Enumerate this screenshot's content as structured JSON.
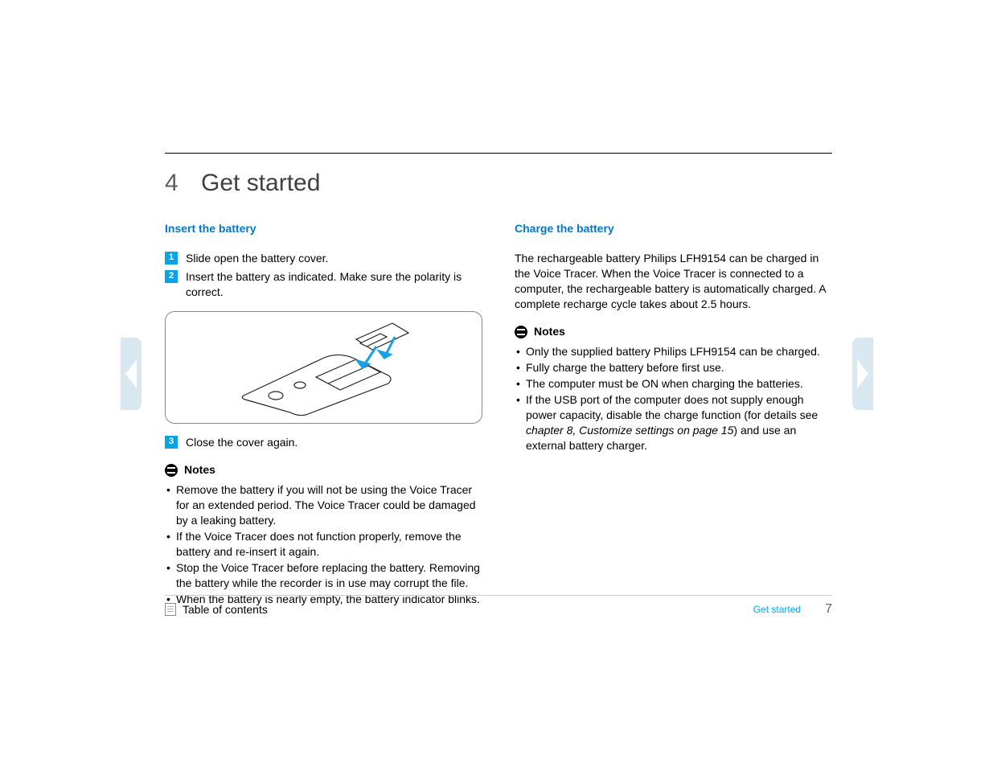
{
  "chapter": {
    "number": "4",
    "title": "Get started"
  },
  "left": {
    "heading": "Insert the battery",
    "steps": {
      "s1": {
        "num": "1",
        "text": "Slide open the battery cover."
      },
      "s2": {
        "num": "2",
        "text": "Insert the battery as indicated. Make sure the polarity is correct."
      },
      "s3": {
        "num": "3",
        "text": "Close the cover again."
      }
    },
    "notes_label": "Notes",
    "notes": {
      "n1": "Remove the battery if you will not be using the Voice Tracer for an extended period. The Voice Tracer could be damaged by a leaking battery.",
      "n2": "If the Voice Tracer does not function properly, remove the battery and re-insert it again.",
      "n3": "Stop the Voice Tracer before replacing the battery. Removing the battery while the recorder is in use may corrupt the file.",
      "n4": "When the battery is nearly empty, the battery indicator blinks."
    }
  },
  "right": {
    "heading": "Charge the battery",
    "para": "The rechargeable battery Philips LFH9154 can be charged in the Voice Tracer. When the Voice Tracer is connected to a computer, the rechargeable battery is automatically charged. A complete recharge cycle takes about 2.5 hours.",
    "notes_label": "Notes",
    "notes": {
      "n1": "Only the supplied battery Philips LFH9154 can be charged.",
      "n2": "Fully charge the battery before first use.",
      "n3": "The computer must be ON when charging the batteries.",
      "n4a": "If the USB port of the computer does not supply enough power capacity, disable the charge function (for details see ",
      "n4b": "chapter 8, Customize settings on page 15",
      "n4c": ") and use an external battery charger."
    }
  },
  "footer": {
    "toc": "Table of contents",
    "section": "Get started",
    "page": "7"
  }
}
